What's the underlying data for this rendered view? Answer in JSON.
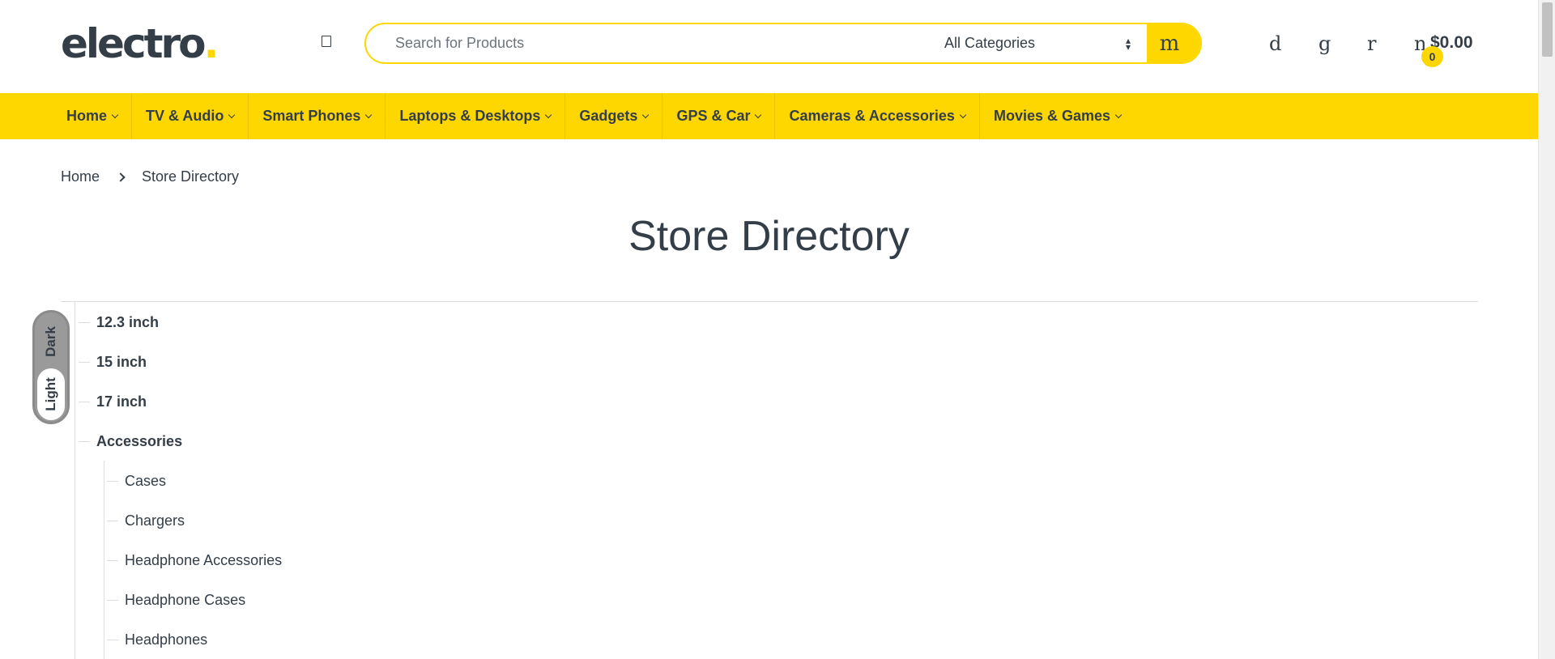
{
  "header": {
    "logo": {
      "text": "electro",
      "dot": ".",
      "dot_color": "#fed700"
    },
    "menu_icon": "hamburger-icon",
    "search": {
      "placeholder": "Search for Products",
      "category_selected": "All Categories",
      "button_icon_glyph": "m",
      "button_icon": "search-icon"
    },
    "icons": [
      {
        "name": "compare-icon",
        "glyph": "d"
      },
      {
        "name": "wishlist-icon",
        "glyph": "g"
      },
      {
        "name": "account-icon",
        "glyph": "r"
      },
      {
        "name": "cart-icon",
        "glyph": "n"
      }
    ],
    "cart": {
      "total": "$0.00",
      "count": "0"
    }
  },
  "nav": {
    "items": [
      {
        "label": "Home"
      },
      {
        "label": "TV & Audio"
      },
      {
        "label": "Smart Phones"
      },
      {
        "label": "Laptops & Desktops"
      },
      {
        "label": "Gadgets"
      },
      {
        "label": "GPS & Car"
      },
      {
        "label": "Cameras & Accessories"
      },
      {
        "label": "Movies & Games"
      }
    ]
  },
  "breadcrumb": {
    "home": "Home",
    "current": "Store Directory"
  },
  "page": {
    "title": "Store Directory"
  },
  "directory": {
    "top": [
      "12.3 inch",
      "15 inch",
      "17 inch",
      "Accessories"
    ],
    "accessories_children": [
      "Cases",
      "Chargers",
      "Headphone Accessories",
      "Headphone Cases",
      "Headphones"
    ]
  },
  "theme_toggle": {
    "dark_label": "Dark",
    "light_label": "Light",
    "selected": "Light"
  },
  "colors": {
    "accent": "#fed700",
    "text": "#333e48",
    "rule": "#dddddd"
  }
}
